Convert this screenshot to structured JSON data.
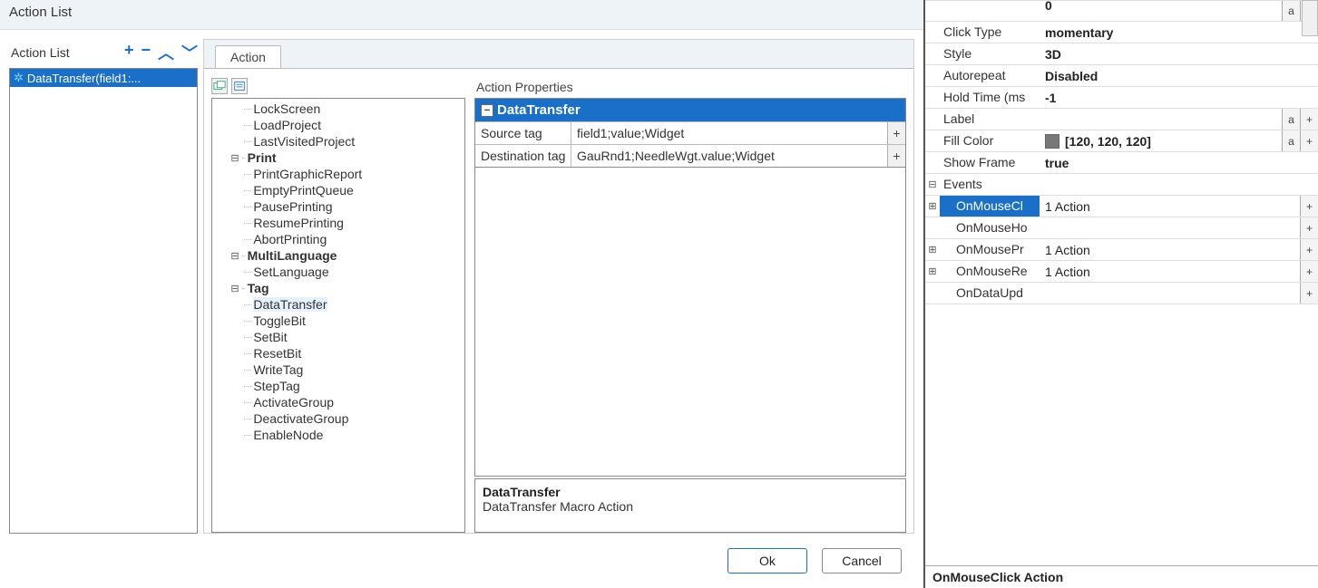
{
  "dialog": {
    "title": "Action List",
    "action_list_label": "Action List",
    "item_label": "DataTransfer(field1:...",
    "tab_label": "Action",
    "ok": "Ok",
    "cancel": "Cancel"
  },
  "tree": {
    "items": [
      {
        "type": "leaf",
        "ind": 2,
        "label": "LockScreen"
      },
      {
        "type": "leaf",
        "ind": 2,
        "label": "LoadProject"
      },
      {
        "type": "leaf",
        "ind": 2,
        "label": "LastVisitedProject"
      },
      {
        "type": "cat",
        "ind": 1,
        "label": "Print",
        "open": true
      },
      {
        "type": "leaf",
        "ind": 2,
        "label": "PrintGraphicReport"
      },
      {
        "type": "leaf",
        "ind": 2,
        "label": "EmptyPrintQueue"
      },
      {
        "type": "leaf",
        "ind": 2,
        "label": "PausePrinting"
      },
      {
        "type": "leaf",
        "ind": 2,
        "label": "ResumePrinting"
      },
      {
        "type": "leaf",
        "ind": 2,
        "label": "AbortPrinting"
      },
      {
        "type": "cat",
        "ind": 1,
        "label": "MultiLanguage",
        "open": true
      },
      {
        "type": "leaf",
        "ind": 2,
        "label": "SetLanguage"
      },
      {
        "type": "cat",
        "ind": 1,
        "label": "Tag",
        "open": true
      },
      {
        "type": "leaf",
        "ind": 2,
        "label": "DataTransfer",
        "selected": true
      },
      {
        "type": "leaf",
        "ind": 2,
        "label": "ToggleBit"
      },
      {
        "type": "leaf",
        "ind": 2,
        "label": "SetBit"
      },
      {
        "type": "leaf",
        "ind": 2,
        "label": "ResetBit"
      },
      {
        "type": "leaf",
        "ind": 2,
        "label": "WriteTag"
      },
      {
        "type": "leaf",
        "ind": 2,
        "label": "StepTag"
      },
      {
        "type": "leaf",
        "ind": 2,
        "label": "ActivateGroup"
      },
      {
        "type": "leaf",
        "ind": 2,
        "label": "DeactivateGroup"
      },
      {
        "type": "leaf",
        "ind": 2,
        "label": "EnableNode"
      }
    ]
  },
  "props": {
    "title": "Action Properties",
    "header": "DataTransfer",
    "rows": [
      {
        "label": "Source tag",
        "value": "field1;value;Widget"
      },
      {
        "label": "Destination tag",
        "value": "GauRnd1;NeedleWgt.value;Widget"
      }
    ],
    "desc_title": "DataTransfer",
    "desc_body": "DataTransfer Macro Action"
  },
  "right": {
    "rows": [
      {
        "exp": "",
        "label": "Click Type",
        "value": "momentary",
        "btns": []
      },
      {
        "exp": "",
        "label": "Style",
        "value": "3D",
        "btns": []
      },
      {
        "exp": "",
        "label": "Autorepeat",
        "value": "Disabled",
        "btns": []
      },
      {
        "exp": "",
        "label": "Hold Time (ms",
        "value": "-1",
        "btns": []
      },
      {
        "exp": "",
        "label": "Label",
        "value": "",
        "btns": [
          "a",
          "+"
        ]
      },
      {
        "exp": "",
        "label": "Fill Color",
        "value": "[120, 120, 120]",
        "swatch": true,
        "btns": [
          "a",
          "+"
        ]
      },
      {
        "exp": "",
        "label": "Show Frame",
        "value": "true",
        "btns": []
      }
    ],
    "events_label": "Events",
    "events": [
      {
        "exp": "+",
        "label": "OnMouseCl",
        "value": "1 Action",
        "selected": true,
        "btns": [
          "+"
        ]
      },
      {
        "exp": "",
        "label": "OnMouseHo",
        "value": "",
        "btns": [
          "+"
        ]
      },
      {
        "exp": "+",
        "label": "OnMousePr",
        "value": "1 Action",
        "btns": [
          "+"
        ]
      },
      {
        "exp": "+",
        "label": "OnMouseRe",
        "value": "1 Action",
        "btns": [
          "+"
        ]
      },
      {
        "exp": "",
        "label": "OnDataUpd",
        "value": "",
        "btns": [
          "+"
        ]
      }
    ],
    "footer": "OnMouseClick Action"
  },
  "topright_value": "0"
}
